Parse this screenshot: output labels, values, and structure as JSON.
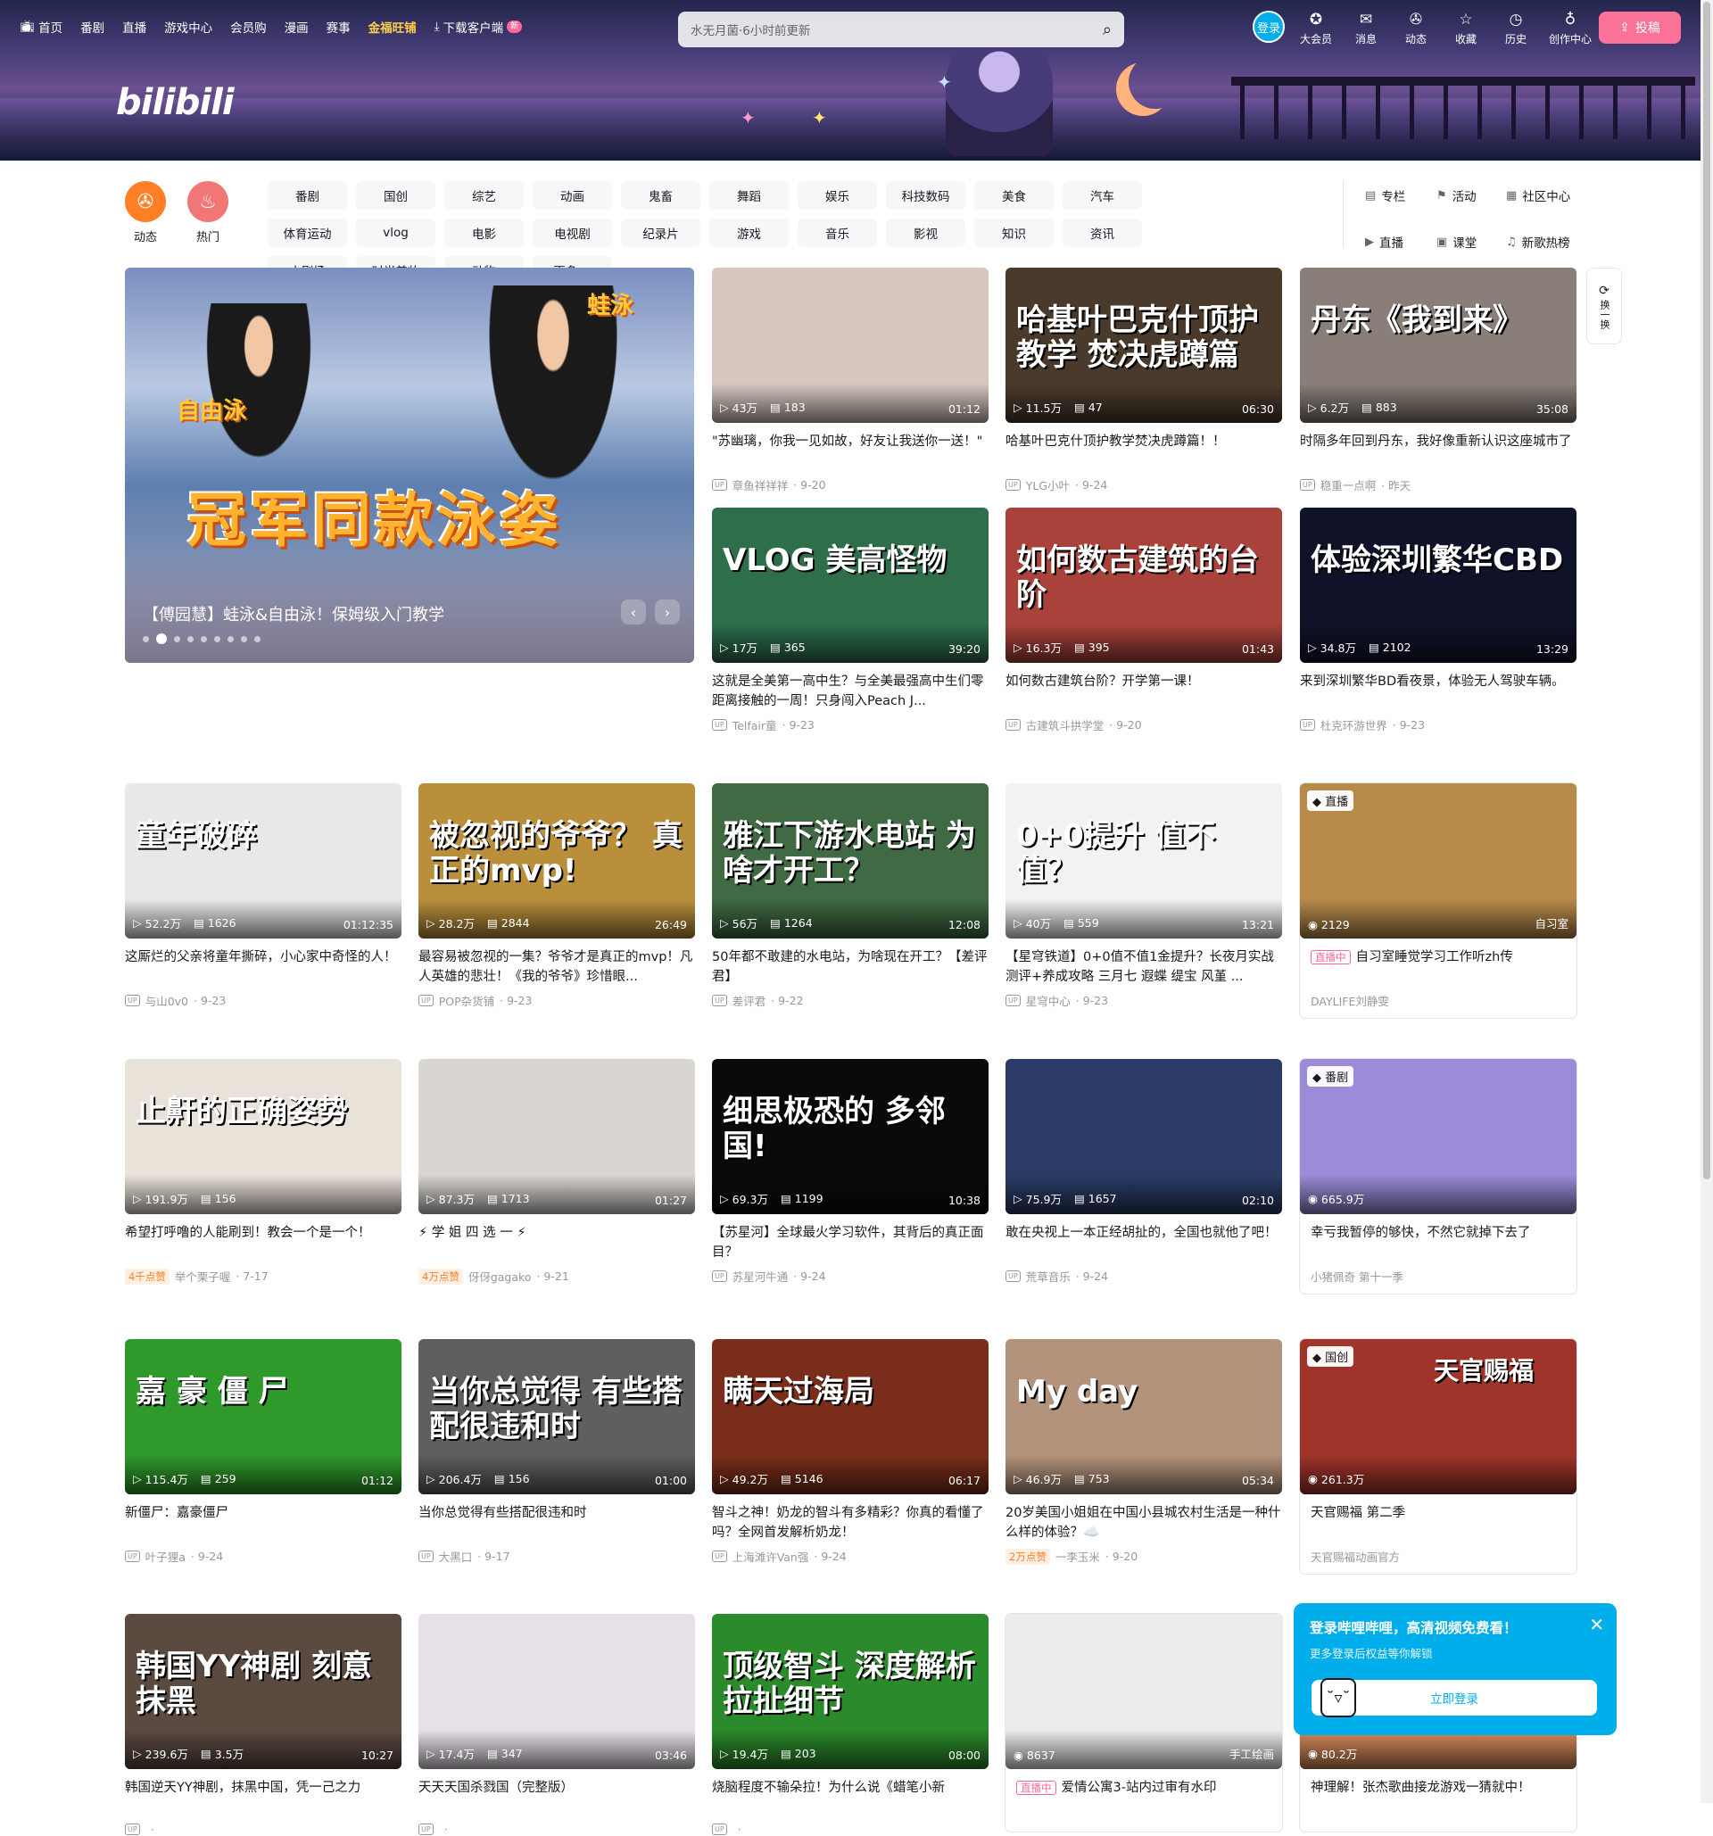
{
  "header": {
    "logo": "bilibili",
    "nav": [
      {
        "label": "首页",
        "icon": "tv-icon"
      },
      {
        "label": "番剧"
      },
      {
        "label": "直播"
      },
      {
        "label": "游戏中心"
      },
      {
        "label": "会员购"
      },
      {
        "label": "漫画"
      },
      {
        "label": "赛事"
      },
      {
        "label": "金福旺铺",
        "highlight": true
      },
      {
        "label": "下载客户端",
        "icon": "download-icon",
        "badge": "新"
      }
    ],
    "search_placeholder": "水无月菌·6小时前更新",
    "login_label": "登录",
    "right_nav": [
      {
        "label": "大会员",
        "icon": "vip-icon"
      },
      {
        "label": "消息",
        "icon": "message-icon"
      },
      {
        "label": "动态",
        "icon": "dynamic-icon"
      },
      {
        "label": "收藏",
        "icon": "star-icon"
      },
      {
        "label": "历史",
        "icon": "clock-icon"
      },
      {
        "label": "创作中心",
        "icon": "bulb-icon"
      }
    ],
    "upload_label": "投稿"
  },
  "channels": {
    "big": [
      {
        "label": "动态",
        "color": "#ff7f24",
        "icon": "dynamic-icon"
      },
      {
        "label": "热门",
        "color": "#f07775",
        "icon": "fire-icon"
      }
    ],
    "grid": [
      "番剧",
      "国创",
      "综艺",
      "动画",
      "鬼畜",
      "舞蹈",
      "娱乐",
      "科技数码",
      "美食",
      "汽车",
      "体育运动",
      "vlog",
      "电影",
      "电视剧",
      "纪录片",
      "游戏",
      "音乐",
      "影视",
      "知识",
      "资讯",
      "小剧场",
      "时尚美妆",
      "动物",
      "更多 ⌄"
    ],
    "side": [
      "专栏",
      "活动",
      "社区中心",
      "直播",
      "课堂",
      "新歌热榜"
    ]
  },
  "carousel": {
    "image_text": "冠军同款泳姿",
    "tag_left": "自由泳",
    "tag_right": "蛙泳",
    "title": "【傅园慧】蛙泳&自由泳！保姆级入门教学"
  },
  "refresh": {
    "icon": "refresh-icon",
    "label": "换一换"
  },
  "videos": [
    {
      "plays": "43万",
      "danmaku": "183",
      "duration": "01:12",
      "title": "\"苏幽璃，你我一见如故，好友让我送你一送！\"",
      "author": "章鱼祥祥祥",
      "date": "9-20",
      "bg": "#d8c7c0",
      "thumb_text": ""
    },
    {
      "plays": "11.5万",
      "danmaku": "47",
      "duration": "06:30",
      "title": "哈基叶巴克什顶护教学焚决虎蹲篇！！",
      "author": "YLG小叶",
      "date": "9-24",
      "bg": "#4a3a2c",
      "thumb_text": "哈基叶巴克什顶护教学 焚决虎蹲篇"
    },
    {
      "plays": "6.2万",
      "danmaku": "883",
      "duration": "35:08",
      "title": "时隔多年回到丹东，我好像重新认识这座城市了",
      "author": "稳重一点啊",
      "date": "昨天",
      "bg": "#8a7f78",
      "thumb_text": "丹东《我到来》"
    },
    {
      "plays": "17万",
      "danmaku": "365",
      "duration": "39:20",
      "title": "这就是全美第一高中生？与全美最强高中生们零距离接触的一周！只身闯入Peach J...",
      "author": "Telfair童",
      "date": "9-23",
      "bg": "#2e6e4a",
      "thumb_text": "VLOG 美高怪物"
    },
    {
      "plays": "16.3万",
      "danmaku": "395",
      "duration": "01:43",
      "title": "如何数古建筑台阶？开学第一课！",
      "author": "古建筑斗拱学堂",
      "date": "9-20",
      "bg": "#a9423a",
      "thumb_text": "如何数古建筑的台阶"
    },
    {
      "plays": "34.8万",
      "danmaku": "2102",
      "duration": "13:29",
      "title": "来到深圳繁华BD看夜景，体验无人驾驶车辆。",
      "author": "杜克环游世界",
      "date": "9-23",
      "bg": "#10122a",
      "thumb_text": "体验深圳繁华CBD"
    },
    {
      "plays": "52.2万",
      "danmaku": "1626",
      "duration": "01:12:35",
      "title": "这厮烂的父亲将童年撕碎，小心家中奇怪的人！",
      "author": "与山0v0",
      "date": "9-23",
      "bg": "#e8e8e8",
      "thumb_text": "童年破碎"
    },
    {
      "plays": "28.2万",
      "danmaku": "2844",
      "duration": "26:49",
      "title": "最容易被忽视的一集？爷爷才是真正的mvp！凡人英雄的悲壮！《我的爷爷》珍惜眼...",
      "author": "POP杂货铺",
      "date": "9-23",
      "bg": "#b98f3b",
      "thumb_text": "被忽视的爷爷？ 真正的mvp!"
    },
    {
      "plays": "56万",
      "danmaku": "1264",
      "duration": "12:08",
      "title": "50年都不敢建的水电站，为啥现在开工？【差评君】",
      "author": "差评君",
      "date": "9-22",
      "bg": "#3f6a43",
      "thumb_text": "雅江下游水电站 为啥才开工？"
    },
    {
      "plays": "40万",
      "danmaku": "559",
      "duration": "13:21",
      "title": "【星穹铁道】0+0值不值1金提升？长夜月实战测评+养成攻略 三月七 遐蝶 缇宝 风堇 ...",
      "author": "星穹中心",
      "date": "9-23",
      "bg": "#f2f2f2",
      "thumb_text": "0+0提升 值不值？"
    },
    {
      "plays": "191.9万",
      "danmaku": "156",
      "duration": "",
      "title": "希望打呼噜的人能刷到！教会一个是一个！",
      "author": "举个栗子喔",
      "date": "7-17",
      "bg": "#e9e2d9",
      "thumb_text": "止鼾的正确姿势",
      "likes": "4千点赞"
    },
    {
      "plays": "87.3万",
      "danmaku": "1713",
      "duration": "01:27",
      "title": "⚡ 学 姐 四 选 一 ⚡",
      "author": "伢伢gagako",
      "date": "9-21",
      "bg": "#d9d6d2",
      "thumb_text": "",
      "likes": "4万点赞"
    },
    {
      "plays": "69.3万",
      "danmaku": "1199",
      "duration": "10:38",
      "title": "【苏星河】全球最火学习软件，其背后的真正面目？",
      "author": "苏星河牛通",
      "date": "9-24",
      "bg": "#0a0a0a",
      "thumb_text": "细思极恐的 多邻国!"
    },
    {
      "plays": "75.9万",
      "danmaku": "1657",
      "duration": "02:10",
      "title": "敢在央视上一本正经胡扯的，全国也就他了吧！",
      "author": "荒草音乐",
      "date": "9-24",
      "bg": "#2a3b66",
      "thumb_text": ""
    },
    {
      "plays": "115.4万",
      "danmaku": "259",
      "duration": "01:12",
      "title": "新僵尸：嘉豪僵尸",
      "author": "叶子狸a",
      "date": "9-24",
      "bg": "#2f9a2b",
      "thumb_text": "嘉 豪 僵 尸"
    },
    {
      "plays": "206.4万",
      "danmaku": "156",
      "duration": "01:00",
      "title": "当你总觉得有些搭配很违和时",
      "author": "大黑口",
      "date": "9-17",
      "bg": "#5f5f5f",
      "thumb_text": "当你总觉得 有些搭配很违和时"
    },
    {
      "plays": "49.2万",
      "danmaku": "5146",
      "duration": "06:17",
      "title": "智斗之神！奶龙的智斗有多精彩？你真的看懂了吗？全网首发解析奶龙！",
      "author": "上海滩许Van强",
      "date": "9-24",
      "bg": "#7a2d1a",
      "thumb_text": "瞒天过海局"
    },
    {
      "plays": "46.9万",
      "danmaku": "753",
      "duration": "05:34",
      "title": "20岁美国小姐姐在中国小县城农村生活是一种什么样的体验？☁️",
      "author": "一李玉米",
      "date": "9-20",
      "bg": "#b4937c",
      "thumb_text": "My day",
      "likes": "2万点赞"
    },
    {
      "plays": "239.6万",
      "danmaku": "3.5万",
      "duration": "10:27",
      "title": "韩国逆天YY神剧，抹黑中国，凭一己之力",
      "author": "",
      "date": "",
      "bg": "#5a4a40",
      "thumb_text": "韩国YY神剧 刻意抹黑"
    },
    {
      "plays": "17.4万",
      "danmaku": "347",
      "duration": "03:46",
      "title": "天天天国杀戮国（完整版）",
      "author": "",
      "date": "",
      "bg": "#e6e0e8",
      "thumb_text": ""
    },
    {
      "plays": "19.4万",
      "danmaku": "203",
      "duration": "08:00",
      "title": "烧脑程度不输朵拉！为什么说《蜡笔小新",
      "author": "",
      "date": "",
      "bg": "#2b8a2b",
      "thumb_text": "顶级智斗 深度解析拉扯细节"
    }
  ],
  "specials": [
    {
      "kind": "直播",
      "kind_icon": "live-icon",
      "plays": "2129",
      "right": "自习室",
      "live_tag": "直播中",
      "title": "自习室睡觉学习工作听zh传",
      "author": "DAYLIFE刘静雯",
      "bg": "#b78a4a"
    },
    {
      "kind": "番剧",
      "kind_icon": "bangumi-icon",
      "plays": "665.9万",
      "right": "",
      "title": "幸亏我暂停的够快，不然它就掉下去了",
      "author": "小猪佩奇 第十一季",
      "bg": "#9b8bd8"
    },
    {
      "kind": "国创",
      "kind_icon": "guochuang-icon",
      "plays": "261.3万",
      "right": "",
      "title": "天官赐福 第二季",
      "author": "天官赐福动画官方",
      "bg": "#a0342a",
      "thumb_text": "天官赐福"
    },
    {
      "kind": "",
      "kind_icon": "",
      "plays": "8637",
      "right": "手工绘画",
      "live_tag": "直播中",
      "title": "爱情公寓3-站内过审有水印",
      "author": "",
      "bg": "#ececec"
    },
    {
      "kind": "",
      "kind_icon": "",
      "plays": "80.2万",
      "right": "",
      "title": "神理解！张杰歌曲接龙游戏一猜就中！",
      "author": "",
      "bg": "#d88a5a"
    }
  ],
  "login_popup": {
    "title": "登录哔哩哔哩，高清视频免费看！",
    "subtitle": "更多登录后权益等你解锁",
    "button": "立即登录"
  }
}
